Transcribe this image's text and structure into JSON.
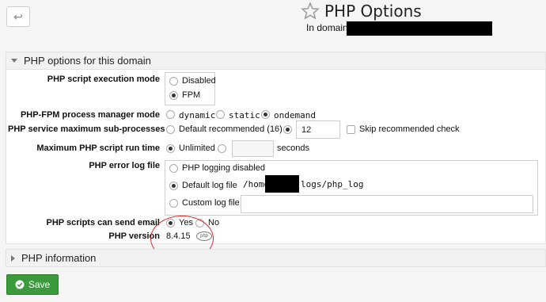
{
  "header": {
    "back_icon": "arrow-left-icon",
    "star_icon": "star-outline-icon",
    "title": "PHP Options",
    "domain_label": "In domain"
  },
  "panel": {
    "heading": "PHP options for this domain",
    "exec_mode": {
      "label": "PHP script execution mode",
      "options": [
        "Disabled",
        "FPM"
      ],
      "selected": "FPM"
    },
    "fpm_mode": {
      "label": "PHP-FPM process manager mode",
      "options": [
        "dynamic",
        "static",
        "ondemand"
      ],
      "selected": "ondemand"
    },
    "subprocesses": {
      "label": "PHP service maximum sub-processes",
      "default_option": "Default recommended (16)",
      "value": "12",
      "skip_label": "Skip recommended check"
    },
    "runtime": {
      "label": "Maximum PHP script run time",
      "unlimited": "Unlimited",
      "value": "",
      "unit": "seconds"
    },
    "errorlog": {
      "label": "PHP error log file",
      "options": [
        "PHP logging disabled",
        "Default log file",
        "Custom log file"
      ],
      "selected": "Default log file",
      "path_prefix": "/home",
      "path_suffix": "logs/php_log",
      "custom_value": ""
    },
    "email": {
      "label": "PHP scripts can send email",
      "yes": "Yes",
      "no": "No",
      "selected": "Yes"
    },
    "version": {
      "label": "PHP version",
      "value": "8.4.15",
      "badge": "php"
    }
  },
  "info_panel": {
    "heading": "PHP information"
  },
  "save": {
    "label": "Save",
    "icon": "check-circle-icon"
  },
  "colors": {
    "save_green": "#3b9a3b",
    "annotation_red": "#d62b2b"
  }
}
